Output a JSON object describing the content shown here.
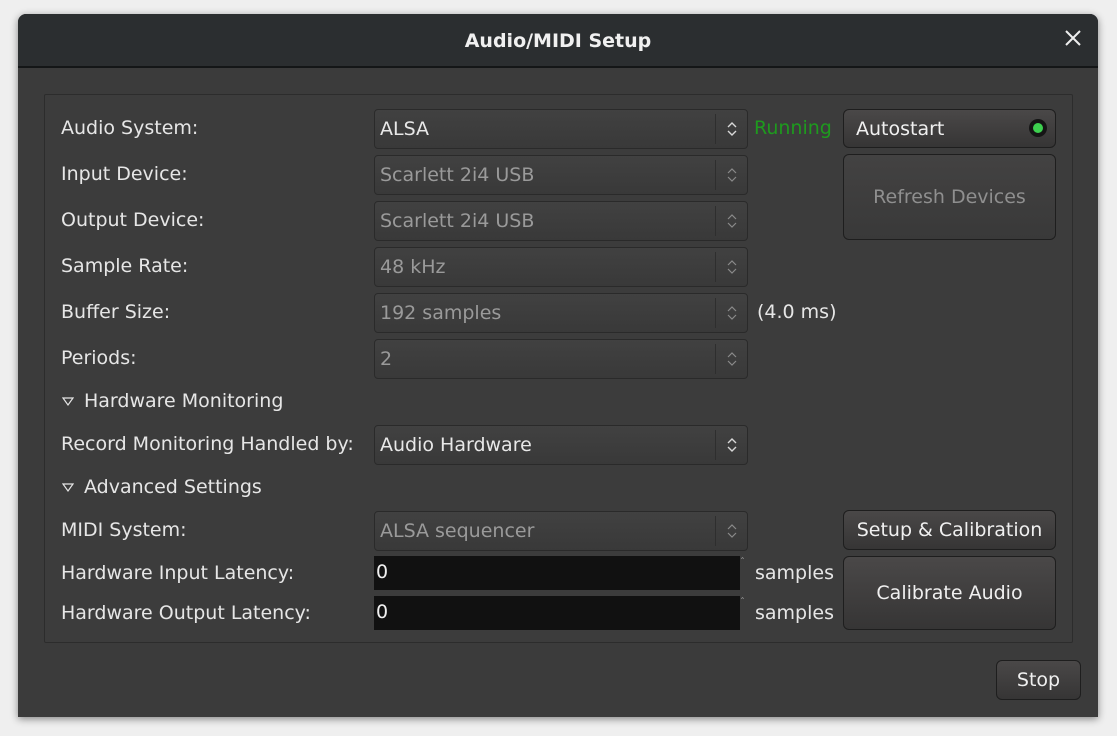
{
  "window": {
    "title": "Audio/MIDI Setup",
    "close_icon": "close-icon"
  },
  "engine": {
    "labels": {
      "audio_system": "Audio System:",
      "input_device": "Input Device:",
      "output_device": "Output Device:",
      "sample_rate": "Sample Rate:",
      "buffer_size": "Buffer Size:",
      "periods": "Periods:"
    },
    "values": {
      "audio_system": "ALSA",
      "input_device": "Scarlett 2i4 USB",
      "output_device": "Scarlett 2i4 USB",
      "sample_rate": "48 kHz",
      "buffer_size": "192 samples",
      "periods": "2"
    },
    "buffer_latency": "(4.0 ms)",
    "status": "Running",
    "status_color": "#1e9a1e",
    "autostart_label": "Autostart",
    "autostart_on": true,
    "refresh_label": "Refresh Devices"
  },
  "hardware_monitoring": {
    "header": "Hardware Monitoring",
    "expanded": true,
    "record_label": "Record Monitoring Handled by:",
    "record_value": "Audio Hardware"
  },
  "advanced": {
    "header": "Advanced Settings",
    "expanded": true,
    "midi_label": "MIDI System:",
    "midi_value": "ALSA sequencer",
    "input_latency_label": "Hardware Input Latency:",
    "input_latency_value": "0",
    "output_latency_label": "Hardware Output Latency:",
    "output_latency_value": "0",
    "unit": "samples",
    "setup_calibration_label": "Setup & Calibration",
    "calibrate_label": "Calibrate Audio"
  },
  "footer": {
    "stop_label": "Stop"
  }
}
